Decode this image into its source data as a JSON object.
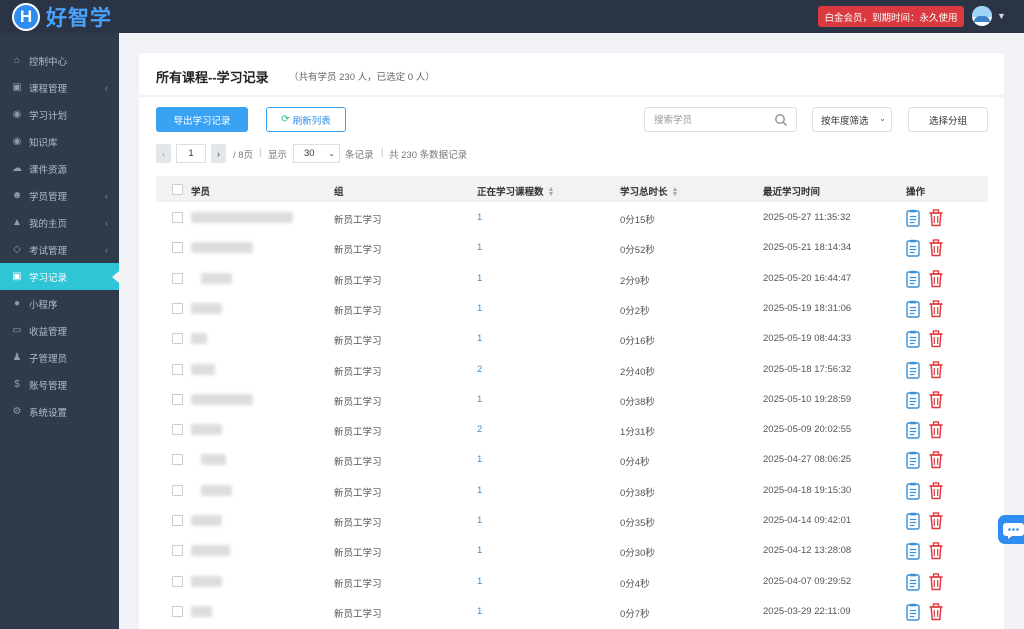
{
  "app": {
    "logo_letter": "H",
    "logo_text": "好智学",
    "vip_text": "白金会员，到期时间：永久使用"
  },
  "sidebar": {
    "items": [
      {
        "label": "控制中心",
        "icon": "home-icon",
        "has_arrow": false
      },
      {
        "label": "课程管理",
        "icon": "book-icon",
        "has_arrow": true
      },
      {
        "label": "学习计划",
        "icon": "eye-icon",
        "has_arrow": false
      },
      {
        "label": "知识库",
        "icon": "eye-icon",
        "has_arrow": false
      },
      {
        "label": "课件资源",
        "icon": "cloud-icon",
        "has_arrow": false
      },
      {
        "label": "学员管理",
        "icon": "users-icon",
        "has_arrow": true
      },
      {
        "label": "我的主页",
        "icon": "graduation-icon",
        "has_arrow": true
      },
      {
        "label": "考试管理",
        "icon": "tag-icon",
        "has_arrow": true
      },
      {
        "label": "学习记录",
        "icon": "book-icon",
        "has_arrow": false,
        "active": true
      },
      {
        "label": "小程序",
        "icon": "wechat-icon",
        "has_arrow": false
      },
      {
        "label": "收益管理",
        "icon": "credit-card-icon",
        "has_arrow": false
      },
      {
        "label": "子管理员",
        "icon": "user-icon",
        "has_arrow": false
      },
      {
        "label": "账号管理",
        "icon": "dollar-icon",
        "has_arrow": false
      },
      {
        "label": "系统设置",
        "icon": "gear-icon",
        "has_arrow": false
      }
    ]
  },
  "page": {
    "title": "所有课程--学习记录",
    "subtitle": "（共有学员 230 人，已选定 0 人）"
  },
  "toolbar": {
    "export_label": "导出学习记录",
    "refresh_label": "刷新列表",
    "search_placeholder": "搜索学员",
    "year_filter": "按年度筛选",
    "group_select": "选择分组"
  },
  "pager": {
    "current_page": "1",
    "total_pages_text": "/ 8页",
    "show_text": "显示",
    "page_size": "30",
    "records_text": "条记录",
    "total_text": "共 230 条数据记录"
  },
  "table": {
    "headers": {
      "student": "学员",
      "group": "组",
      "courses": "正在学习课程数",
      "duration": "学习总时长",
      "last_time": "最近学习时间",
      "actions": "操作"
    },
    "rows": [
      {
        "group": "新员工学习",
        "courses": "1",
        "duration": "0分15秒",
        "last_time": "2025-05-27 11:35:32"
      },
      {
        "group": "新员工学习",
        "courses": "1",
        "duration": "0分52秒",
        "last_time": "2025-05-21 18:14:34"
      },
      {
        "group": "新员工学习",
        "courses": "1",
        "duration": "2分9秒",
        "last_time": "2025-05-20 16:44:47"
      },
      {
        "group": "新员工学习",
        "courses": "1",
        "duration": "0分2秒",
        "last_time": "2025-05-19 18:31:06"
      },
      {
        "group": "新员工学习",
        "courses": "1",
        "duration": "0分16秒",
        "last_time": "2025-05-19 08:44:33"
      },
      {
        "group": "新员工学习",
        "courses": "2",
        "duration": "2分40秒",
        "last_time": "2025-05-18 17:56:32"
      },
      {
        "group": "新员工学习",
        "courses": "1",
        "duration": "0分38秒",
        "last_time": "2025-05-10 19:28:59"
      },
      {
        "group": "新员工学习",
        "courses": "2",
        "duration": "1分31秒",
        "last_time": "2025-05-09 20:02:55"
      },
      {
        "group": "新员工学习",
        "courses": "1",
        "duration": "0分4秒",
        "last_time": "2025-04-27 08:06:25"
      },
      {
        "group": "新员工学习",
        "courses": "1",
        "duration": "0分38秒",
        "last_time": "2025-04-18 19:15:30"
      },
      {
        "group": "新员工学习",
        "courses": "1",
        "duration": "0分35秒",
        "last_time": "2025-04-14 09:42:01"
      },
      {
        "group": "新员工学习",
        "courses": "1",
        "duration": "0分30秒",
        "last_time": "2025-04-12 13:28:08"
      },
      {
        "group": "新员工学习",
        "courses": "1",
        "duration": "0分4秒",
        "last_time": "2025-04-07 09:29:52"
      },
      {
        "group": "新员工学习",
        "courses": "1",
        "duration": "0分7秒",
        "last_time": "2025-03-29 22:11:09"
      }
    ]
  },
  "colors": {
    "topbar": "#2b3445",
    "sidebar": "#2f3a4b",
    "active": "#2ec5d6",
    "primary": "#3aa2f3",
    "danger": "#e0393e",
    "doc_icon": "#3a8fd6"
  }
}
